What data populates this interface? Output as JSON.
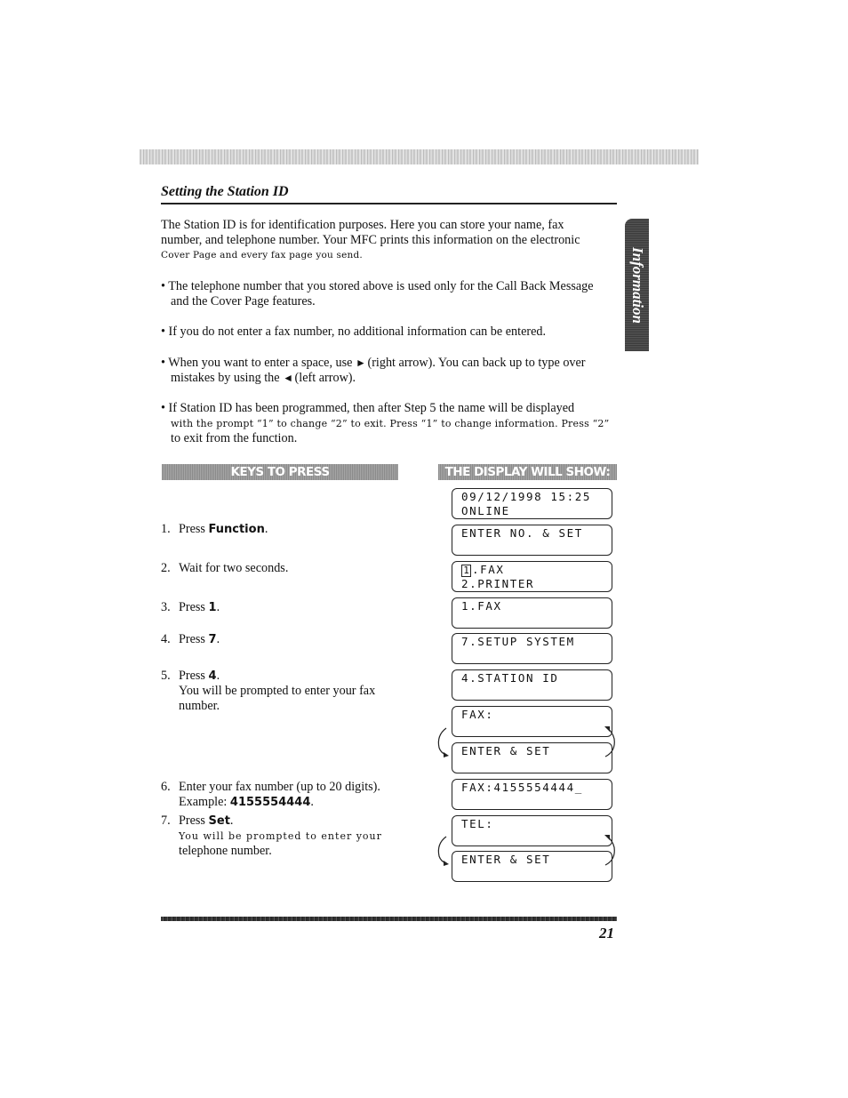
{
  "section": {
    "title": "Setting the Station ID"
  },
  "side_tab": {
    "label": "Information"
  },
  "intro": {
    "line1": "The Station ID is for identification purposes. Here you can store your name, fax",
    "line2": "number, and telephone number. Your MFC prints this information on the electronic",
    "line3": "Cover Page and every fax page you send."
  },
  "bullets": [
    {
      "line1": "• The telephone number that you stored above is used only for the Call Back Message",
      "line2": "and the Cover Page features."
    },
    {
      "line1": "• If you do not enter a fax number, no additional information can be entered."
    },
    {
      "line1a": "• When you want to enter a space, use ",
      "right_arrow_icon": "►",
      "line1b": " (right arrow). You can back up to type over",
      "line2a": "mistakes by using the ",
      "left_arrow_icon": "◄",
      "line2b": " (left arrow)."
    },
    {
      "line1": "• If Station ID has been programmed, then after Step 5 the name will be displayed",
      "line2": "with the prompt “1” to change “2” to exit.  Press “1” to change information. Press “2”",
      "line3": "to exit from the function."
    }
  ],
  "headers": {
    "keys": "KEYS TO PRESS",
    "display": "THE DISPLAY WILL SHOW:"
  },
  "steps": [
    {
      "num": "1.",
      "pre": "Press ",
      "key": "Function",
      "post": "."
    },
    {
      "num": "2.",
      "text": "Wait for two seconds."
    },
    {
      "num": "3.",
      "pre": "Press ",
      "key": "1",
      "post": "."
    },
    {
      "num": "4.",
      "pre": "Press ",
      "key": "7",
      "post": "."
    },
    {
      "num": "5.",
      "pre": "Press ",
      "key": "4",
      "post": ".",
      "cont1": "You will be prompted to enter your fax",
      "cont2": "number."
    },
    {
      "num": "6.",
      "text": "Enter your fax number (up to 20 digits).",
      "cont_pre": "Example: ",
      "cont_key": "4155554444",
      "cont_post": "."
    },
    {
      "num": "7.",
      "pre": "Press ",
      "key": "Set",
      "post": ".",
      "cont1": "You will be prompted to enter your",
      "cont2": "telephone number."
    }
  ],
  "displays": [
    {
      "line1": "09/12/1998 15:25",
      "line2": "ONLINE"
    },
    {
      "line1": "ENTER NO. & SET",
      "line2": ""
    },
    {
      "cursor": "1",
      "line1": ".FAX",
      "line2": "2.PRINTER"
    },
    {
      "line1": "1.FAX",
      "line2": ""
    },
    {
      "line1": "7.SETUP SYSTEM",
      "line2": ""
    },
    {
      "line1": "4.STATION ID",
      "line2": ""
    },
    {
      "line1": "FAX:",
      "line2": ""
    },
    {
      "line1": "ENTER & SET",
      "line2": ""
    },
    {
      "line1": "FAX:4155554444_",
      "line2": ""
    },
    {
      "line1": "TEL:",
      "line2": ""
    },
    {
      "line1": "ENTER & SET",
      "line2": ""
    }
  ],
  "page_number": "21"
}
